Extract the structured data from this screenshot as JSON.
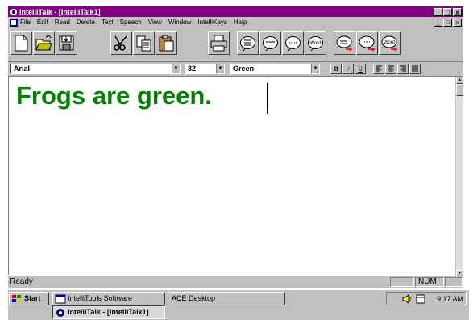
{
  "window": {
    "title": "IntelliTalk - [IntelliTalk1]",
    "controls": [
      "_",
      "õ",
      "x"
    ]
  },
  "menu": {
    "items": [
      "File",
      "Edit",
      "Read",
      "Delete",
      "Text",
      "Speech",
      "View",
      "Window",
      "IntelliKeys",
      "Help"
    ],
    "controls": [
      "_",
      "õ",
      "x"
    ]
  },
  "toolbar": {
    "buttons": [
      {
        "icon": "new-document-icon"
      },
      {
        "icon": "open-folder-icon"
      },
      {
        "icon": "save-disk-icon"
      },
      {
        "icon": "cut-scissors-icon"
      },
      {
        "icon": "copy-icon"
      },
      {
        "icon": "paste-clipboard-icon"
      },
      {
        "icon": "print-icon"
      },
      {
        "icon": "speak-paragraph-icon"
      },
      {
        "icon": "speak-sentence-icon"
      },
      {
        "icon": "speak-phrase-icon"
      },
      {
        "icon": "speak-word-icon",
        "label": "Word"
      },
      {
        "icon": "speech-arrow-paragraph-icon"
      },
      {
        "icon": "speech-arrow-sentence-icon"
      },
      {
        "icon": "speech-arrow-word-icon",
        "label": "Word"
      }
    ]
  },
  "format": {
    "font": "Arial",
    "size": "32",
    "color": "Green",
    "bold": "B",
    "italic": "/",
    "underline": "U"
  },
  "document": {
    "text": "Frogs are green.",
    "text_color": "#008000"
  },
  "status": {
    "ready": "Ready",
    "num": "NUM"
  },
  "taskbar": {
    "start": "Start",
    "tasks": [
      "IntelliTools Software",
      "ACE Desktop",
      "IntelliTalk - [IntelliTalk1]"
    ],
    "time": "9:17 AM"
  }
}
